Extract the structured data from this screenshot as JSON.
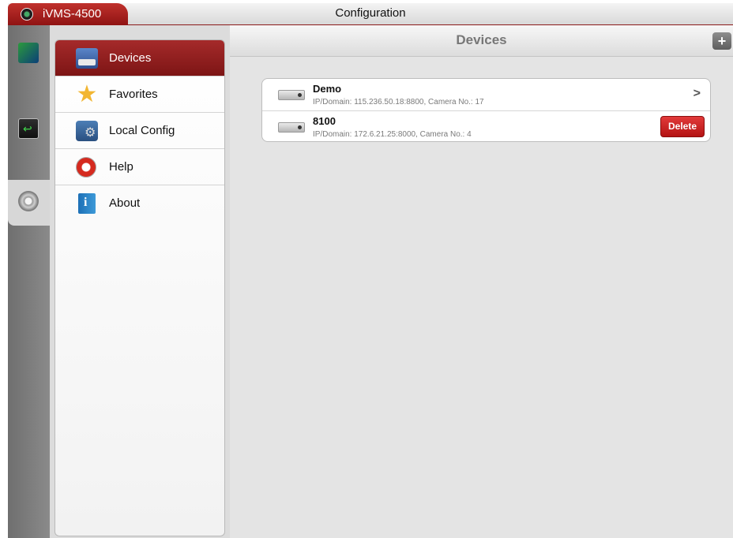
{
  "app": {
    "name": "iVMS-4500",
    "page_title": "Configuration"
  },
  "rail": {
    "items": [
      {
        "name": "live-view",
        "icon": "live-view-icon",
        "active": false
      },
      {
        "name": "remote-playback",
        "icon": "playback-icon",
        "active": false
      },
      {
        "name": "configuration",
        "icon": "gear-icon",
        "active": true
      }
    ]
  },
  "menu": {
    "items": [
      {
        "label": "Devices",
        "icon": "devices-icon",
        "selected": true
      },
      {
        "label": "Favorites",
        "icon": "star-icon",
        "selected": false
      },
      {
        "label": "Local Config",
        "icon": "local-config-icon",
        "selected": false
      },
      {
        "label": "Help",
        "icon": "lifebuoy-icon",
        "selected": false
      },
      {
        "label": "About",
        "icon": "info-book-icon",
        "selected": false
      }
    ]
  },
  "content": {
    "title": "Devices",
    "add_button": "+",
    "devices": [
      {
        "name": "Demo",
        "info": "IP/Domain: 115.236.50.18:8800, Camera No.: 17",
        "action": ">"
      },
      {
        "name": "8100",
        "info": "IP/Domain: 172.6.21.25:8000, Camera No.: 4",
        "action": "Delete"
      }
    ]
  },
  "colors": {
    "accent_red": "#8f1313",
    "delete_red": "#c91f1f"
  }
}
